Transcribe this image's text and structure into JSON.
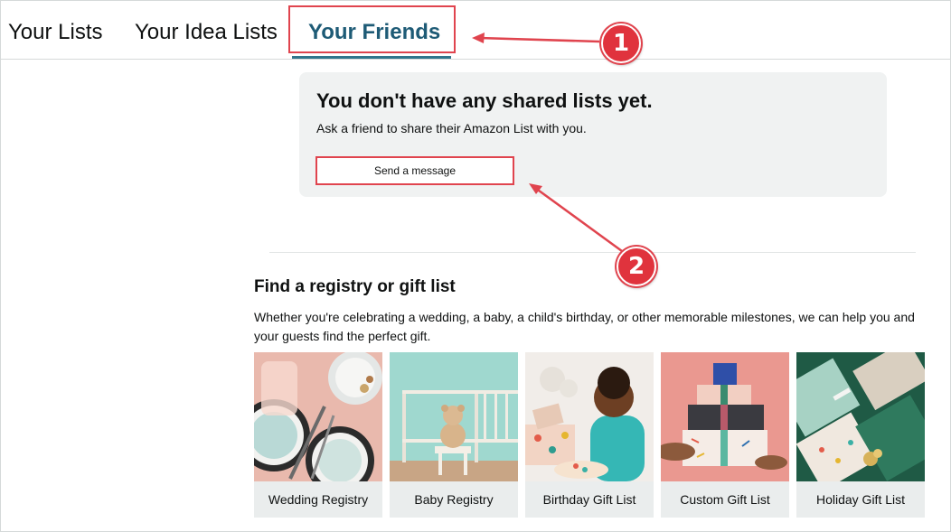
{
  "tabs": [
    {
      "label": "Your Lists"
    },
    {
      "label": "Your Idea Lists"
    },
    {
      "label": "Your Friends"
    }
  ],
  "annotations": {
    "badge_1": "1",
    "badge_2": "2",
    "color": "#e0444e"
  },
  "shared": {
    "title": "You don't have any shared lists yet.",
    "subtitle": "Ask a friend to share their Amazon List with you.",
    "button": "Send a message"
  },
  "registry": {
    "title": "Find a registry or gift list",
    "description": "Whether you're celebrating a wedding, a baby, a child's birthday, or other memorable milestones, we can help you and your guests find the perfect gift.",
    "cards": [
      {
        "label": "Wedding Registry"
      },
      {
        "label": "Baby Registry"
      },
      {
        "label": "Birthday Gift List"
      },
      {
        "label": "Custom Gift List"
      },
      {
        "label": "Holiday Gift List"
      }
    ]
  },
  "colors": {
    "active_tab": "#1e5b76",
    "underline": "#31758c",
    "panel_bg": "#f0f2f2"
  }
}
